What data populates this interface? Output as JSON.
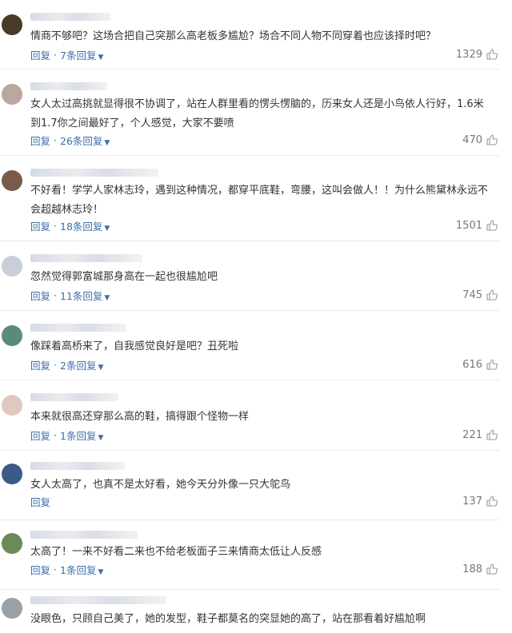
{
  "comments": [
    {
      "text": [
        "情商不够吧？这场合把自己突那么高老板多尴尬？场合不同人物不同穿着也应该择时吧？"
      ],
      "reply_label": "回复",
      "replies_label": "7条回复",
      "likes": "1329",
      "avatar_color": "#4a3a2a"
    },
    {
      "text": [
        "女人太过高挑就显得很不协调了，站在人群里看的愣头愣脑的，历来女人还是小鸟依人行好，1.6米",
        "到1.7你之间最好了，个人感觉，大家不要喷"
      ],
      "reply_label": "回复",
      "replies_label": "26条回复",
      "likes": "470",
      "avatar_color": "#b8a8a0"
    },
    {
      "text": [
        "不好看！学学人家林志玲，遇到这种情况，都穿平底鞋，弯腰，这叫会做人！！为什么熊黛林永远不",
        "会超越林志玲！"
      ],
      "reply_label": "回复",
      "replies_label": "18条回复",
      "likes": "1501",
      "avatar_color": "#7a5a48"
    },
    {
      "text": [
        "忽然觉得郭富城那身高在一起也很尴尬吧"
      ],
      "reply_label": "回复",
      "replies_label": "11条回复",
      "likes": "745",
      "avatar_color": "#c8cfd8"
    },
    {
      "text": [
        "像踩着高桥来了，自我感觉良好是吧？丑死啦"
      ],
      "reply_label": "回复",
      "replies_label": "2条回复",
      "likes": "616",
      "avatar_color": "#5a8a7a"
    },
    {
      "text": [
        "本来就很高还穿那么高的鞋，搞得跟个怪物一样"
      ],
      "reply_label": "回复",
      "replies_label": "1条回复",
      "likes": "221",
      "avatar_color": "#e0c8c0"
    },
    {
      "text": [
        "女人太高了，也真不是太好看，她今天分外像一只大鸵鸟"
      ],
      "reply_label": "回复",
      "replies_label": "",
      "likes": "137",
      "avatar_color": "#3a5a8a"
    },
    {
      "text": [
        "太高了！一来不好看二来也不给老板面子三来情商太低让人反感"
      ],
      "reply_label": "回复",
      "replies_label": "1条回复",
      "likes": "188",
      "avatar_color": "#6a8a5a"
    },
    {
      "text": [
        "没眼色，只顾自己美了，她的发型，鞋子都莫名的突显她的高了，站在那看着好尴尬啊"
      ],
      "reply_label": "",
      "replies_label": "",
      "likes": "",
      "avatar_color": "#9aa0a8"
    }
  ],
  "colors": {
    "link": "#3d6ea8",
    "text": "#333333",
    "count": "#777777",
    "divider": "#eaeaea"
  },
  "icons": {
    "like": "thumbs-up-icon",
    "expand": "chevron-down-icon"
  }
}
